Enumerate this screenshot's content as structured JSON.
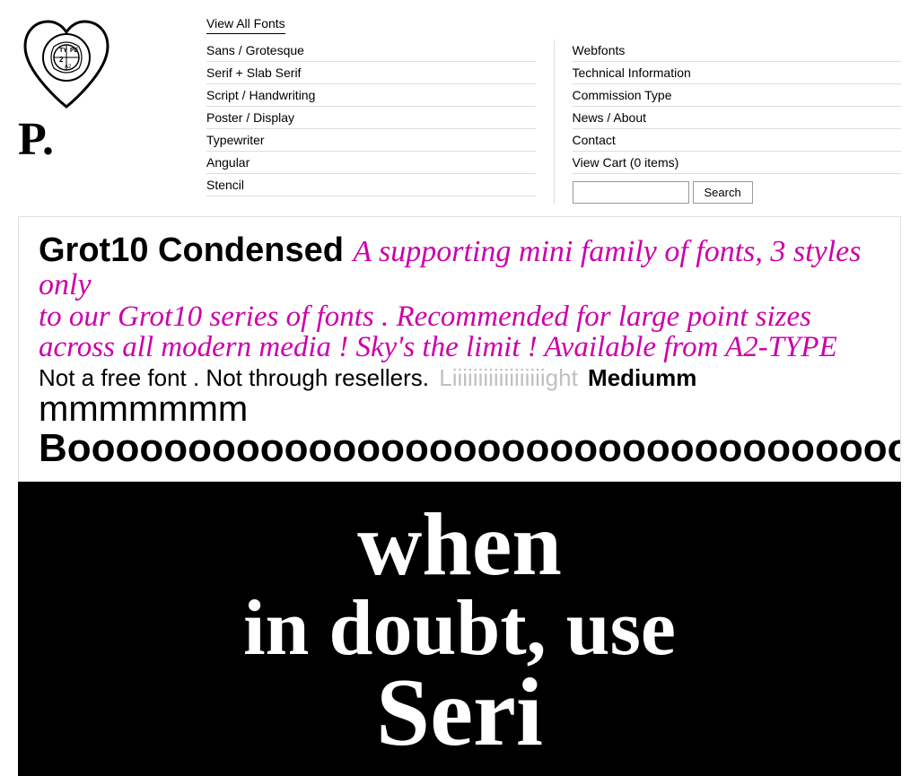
{
  "logo": {
    "letter": "P."
  },
  "nav": {
    "view_all": "View All Fonts",
    "col1": {
      "items": [
        "Sans / Grotesque",
        "Serif + Slab Serif",
        "Script / Handwriting",
        "Poster / Display",
        "Typewriter",
        "Angular",
        "Stencil"
      ]
    },
    "col2": {
      "items": [
        "Webfonts",
        "Technical Information",
        "Commission Type",
        "News / About",
        "Contact",
        "View Cart (0 items)"
      ]
    },
    "search": {
      "placeholder": "",
      "button_label": "Search"
    }
  },
  "banner1": {
    "line1_bold": "Grot10 Condensed",
    "line1_italic": "A supporting mini family of fonts, 3 styles only",
    "line2": "to our Grot10 series of fonts . Recommended for large point sizes",
    "line3": "across all modern media ! Sky's the limit ! Available from A2-TYPE",
    "line4_black": "Not a free font . Not through resellers.",
    "line4_light": "Liiiiiiiiiiiiiiiiiight",
    "line4_medium": "Mediumm",
    "line5_light": "mmmmmmm",
    "line5_bold": "Booooooooooooooooooooooooooooooooooooooooooold"
  },
  "banner2": {
    "line1": "when",
    "line2": "in doubt, use",
    "line3": "Seri"
  }
}
